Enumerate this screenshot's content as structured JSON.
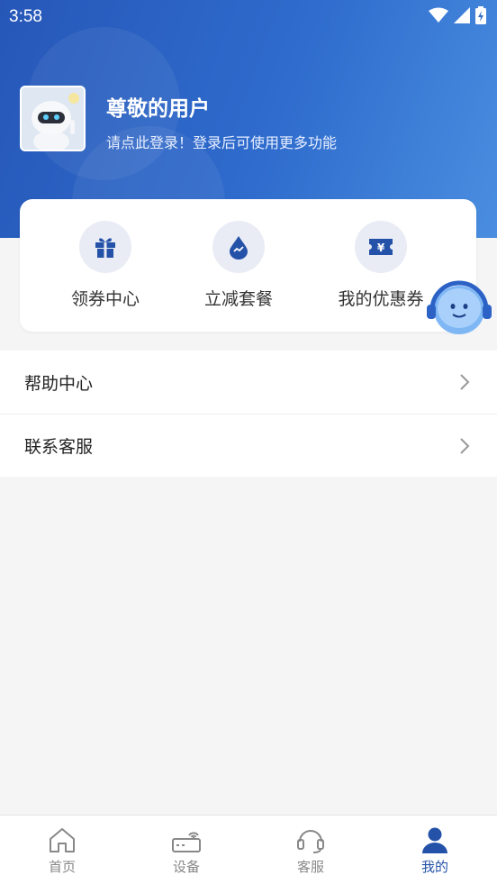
{
  "status_bar": {
    "time": "3:58"
  },
  "profile": {
    "name": "尊敬的用户",
    "subtitle": "请点此登录！登录后可使用更多功能"
  },
  "quick_actions": [
    {
      "label": "领券中心",
      "icon": "gift-icon"
    },
    {
      "label": "立减套餐",
      "icon": "drop-icon"
    },
    {
      "label": "我的优惠券",
      "icon": "ticket-icon"
    }
  ],
  "menu": [
    {
      "label": "帮助中心"
    },
    {
      "label": "联系客服"
    }
  ],
  "tabbar": [
    {
      "label": "首页",
      "icon": "home-icon"
    },
    {
      "label": "设备",
      "icon": "router-icon"
    },
    {
      "label": "客服",
      "icon": "headset-icon"
    },
    {
      "label": "我的",
      "icon": "user-icon",
      "active": true
    }
  ],
  "colors": {
    "primary": "#2452a8",
    "header_start": "#2657b8",
    "header_end": "#4a8ee0",
    "icon_bg": "#e9ecf5"
  }
}
